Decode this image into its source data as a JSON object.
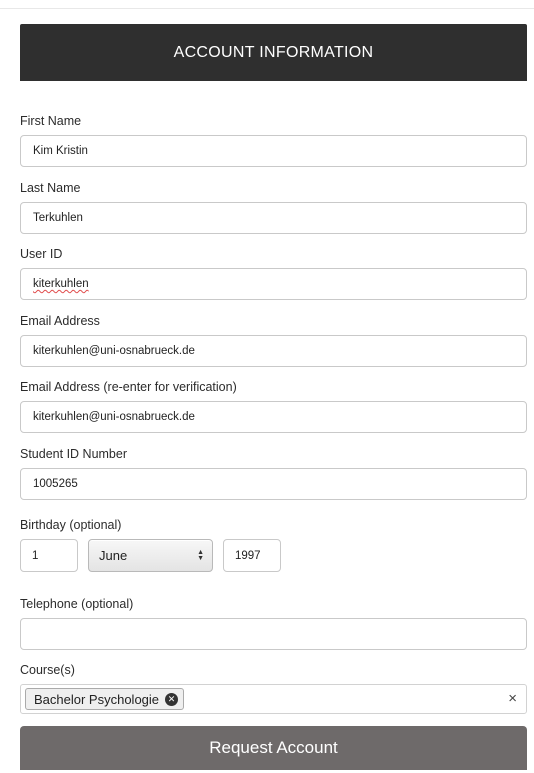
{
  "header": {
    "title": "ACCOUNT INFORMATION"
  },
  "fields": {
    "first_name": {
      "label": "First Name",
      "value": "Kim Kristin"
    },
    "last_name": {
      "label": "Last Name",
      "value": "Terkuhlen"
    },
    "user_id": {
      "label": "User ID",
      "value": "kiterkuhlen"
    },
    "email": {
      "label": "Email Address",
      "value": "kiterkuhlen@uni-osnabrueck.de"
    },
    "email_verify": {
      "label": "Email Address (re-enter for verification)",
      "value": "kiterkuhlen@uni-osnabrueck.de"
    },
    "student_id": {
      "label": "Student ID Number",
      "value": "1005265"
    },
    "birthday": {
      "label": "Birthday (optional)",
      "day": "1",
      "month": "June",
      "year": "1997"
    },
    "telephone": {
      "label": "Telephone (optional)",
      "value": ""
    },
    "courses": {
      "label": "Course(s)",
      "selected": [
        "Bachelor Psychologie"
      ],
      "clear_symbol": "×"
    }
  },
  "submit": {
    "label": "Request Account"
  }
}
